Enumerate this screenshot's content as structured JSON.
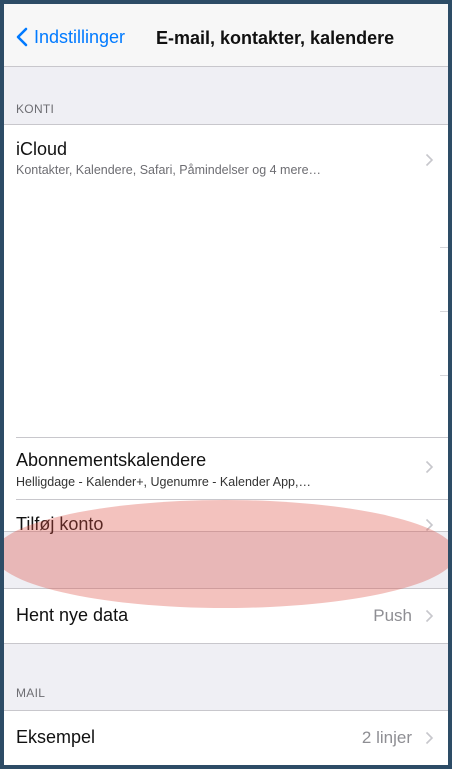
{
  "colors": {
    "accent": "#007aff",
    "highlight": "#dc5046",
    "frame": "#2d4c66"
  },
  "navbar": {
    "back_label": "Indstillinger",
    "back_icon": "chevron-left-icon",
    "title": "E-mail, kontakter, kalendere"
  },
  "accounts": {
    "header": "KONTI",
    "icloud": {
      "title": "iCloud",
      "subtitle": "Kontakter, Kalendere, Safari, Påmindelser og 4 mere…"
    },
    "subscriptions": {
      "title": "Abonnementskalendere",
      "subtitle": "Helligdage - Kalender+, Ugenumre - Kalender App,…"
    },
    "add_account": {
      "title": "Tilføj konto"
    }
  },
  "fetch": {
    "title": "Hent nye data",
    "value": "Push"
  },
  "mail": {
    "header": "MAIL",
    "preview": {
      "title": "Eksempel",
      "value": "2 linjer"
    }
  }
}
